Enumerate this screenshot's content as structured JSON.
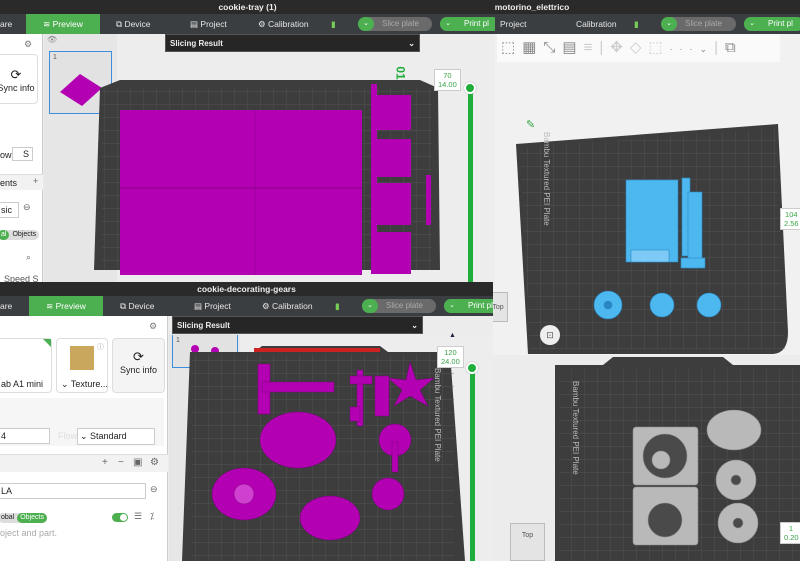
{
  "windows": {
    "tray": {
      "title": "cookie-tray (1)",
      "tabs": [
        "are",
        "Preview",
        "Device",
        "Project",
        "Calibration"
      ],
      "slice_label": "Slice plate",
      "print_label": "Print pl",
      "slicing_result": "Slicing Result",
      "plate_number": "1",
      "sidebar": {
        "sync_info": "Sync info",
        "flow_label": "ow",
        "flow_value": "S",
        "section": "ents",
        "filament": "sic",
        "seg_global": "al",
        "seg_objects": "Objects",
        "speed_label": "Speed S"
      },
      "layer_top": "70",
      "height_top": "14.00",
      "plate_mark": "01"
    },
    "motorino": {
      "title": "_motorino_elettrico",
      "tabs": [
        "Project",
        "Calibration"
      ],
      "slice_label": "Slice plate",
      "print_label": "Print pl",
      "plate_text": "Bambu Textured PEI Plate",
      "layer_top": "104",
      "height_top": "2.56",
      "view_cube": "Top"
    },
    "gears": {
      "title": "cookie-decorating-gears",
      "tabs": [
        "are",
        "Preview",
        "Device",
        "Project",
        "Calibration"
      ],
      "slice_label": "Slice plate",
      "print_label": "Print pl",
      "slicing_result": "Slicing Result",
      "plate_number": "1",
      "sidebar": {
        "printer": "ab A1 mini",
        "plate_type": "Texture...",
        "sync_info": "Sync info",
        "nozzle": "4",
        "flow_label": "Flow",
        "flow_value": "Standard",
        "filament": "LA",
        "seg_global": "obal",
        "seg_objects": "Objects",
        "hint": "oject and part."
      },
      "layer_top": "120",
      "height_top": "24.00",
      "plate_text": "Bambu Textured PEI Plate"
    },
    "back": {
      "plate_text": "Bambu Textured PEI Plate",
      "layer_bottom": "1",
      "height_bottom": "0.20",
      "view_cube": "Top"
    }
  },
  "colors": {
    "accent": "#4caf50",
    "magenta": "#b300b3",
    "blue_part": "#4db8f0",
    "gray_part": "#b9b9b9",
    "plate": "#3f3f3f"
  }
}
